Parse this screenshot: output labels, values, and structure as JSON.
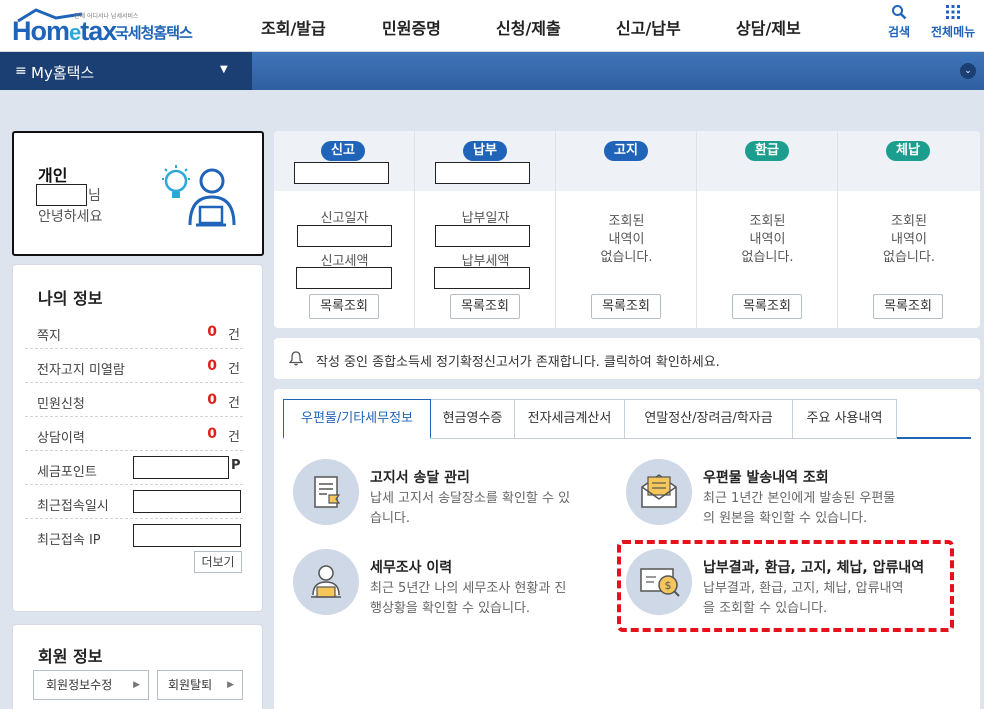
{
  "header": {
    "logo_text_main": "Hom",
    "logo_text_e": "e",
    "logo_text_tax": "tax",
    "logo_tagline": "언제 어디서나 납세서비스",
    "logo_korean": "국세청홈택스",
    "nav": [
      "조회/발급",
      "민원증명",
      "신청/제출",
      "신고/납부",
      "상담/제보"
    ],
    "search_label": "검색",
    "menu_label": "전체메뉴"
  },
  "mybar": {
    "hamburger": "≡",
    "title": "My홈택스",
    "dropdown": "▼",
    "collapse": "⌄"
  },
  "personal": {
    "type": "개인",
    "suffix": "님",
    "greeting": "안녕하세요"
  },
  "my_info": {
    "title": "나의 정보",
    "rows": [
      {
        "label": "쪽지",
        "count": "0",
        "unit": "건"
      },
      {
        "label": "전자고지 미열람",
        "count": "0",
        "unit": "건"
      },
      {
        "label": "민원신청",
        "count": "0",
        "unit": "건"
      },
      {
        "label": "상담이력",
        "count": "0",
        "unit": "건"
      }
    ],
    "points_label": "세금포인트",
    "points_unit": "P",
    "last_access_label": "최근접속일시",
    "last_ip_label": "최근접속 IP",
    "more": "더보기"
  },
  "member": {
    "title": "회원 정보",
    "edit": "회원정보수정",
    "withdraw": "회원탈퇴"
  },
  "status": {
    "columns": [
      {
        "pill": "신고",
        "label1": "신고일자",
        "label2": "신고세액",
        "button": "목록조회"
      },
      {
        "pill": "납부",
        "label1": "납부일자",
        "label2": "납부세액",
        "button": "목록조회"
      },
      {
        "pill": "고지",
        "nodata": [
          "조회된",
          "내역이",
          "없습니다."
        ],
        "button": "목록조회"
      },
      {
        "pill": "환급",
        "nodata": [
          "조회된",
          "내역이",
          "없습니다."
        ],
        "button": "목록조회"
      },
      {
        "pill": "체납",
        "nodata": [
          "조회된",
          "내역이",
          "없습니다."
        ],
        "button": "목록조회"
      }
    ]
  },
  "notice": {
    "text": "작성 중인 종합소득세 정기확정신고서가 존재합니다. 클릭하여 확인하세요."
  },
  "tabs": [
    "우편물/기타세무정보",
    "현금영수증",
    "전자세금계산서",
    "연말정산/장려금/학자금",
    "주요 사용내역"
  ],
  "services": [
    {
      "title": "고지서 송달 관리",
      "desc1": "납세 고지서 송달장소를 확인할 수 있",
      "desc2": "습니다."
    },
    {
      "title": "우편물 발송내역 조회",
      "desc1": "최근 1년간 본인에게 발송된 우편물",
      "desc2": "의 원본을 확인할 수 있습니다."
    },
    {
      "title": "세무조사 이력",
      "desc1": "최근 5년간 나의 세무조사 현황과 진",
      "desc2": "행상황을 확인할 수 있습니다."
    },
    {
      "title": "납부결과, 환급, 고지, 체납, 압류내역",
      "desc1": "납부결과, 환급, 고지, 체납, 압류내역",
      "desc2": "을 조회할 수 있습니다."
    }
  ],
  "colors": {
    "brand_blue": "#1f64b9",
    "nav_dark": "#1c3f73",
    "count_red": "#e0211b",
    "highlight_red": "#e8101b",
    "pill_green": "#1c9e8f"
  }
}
